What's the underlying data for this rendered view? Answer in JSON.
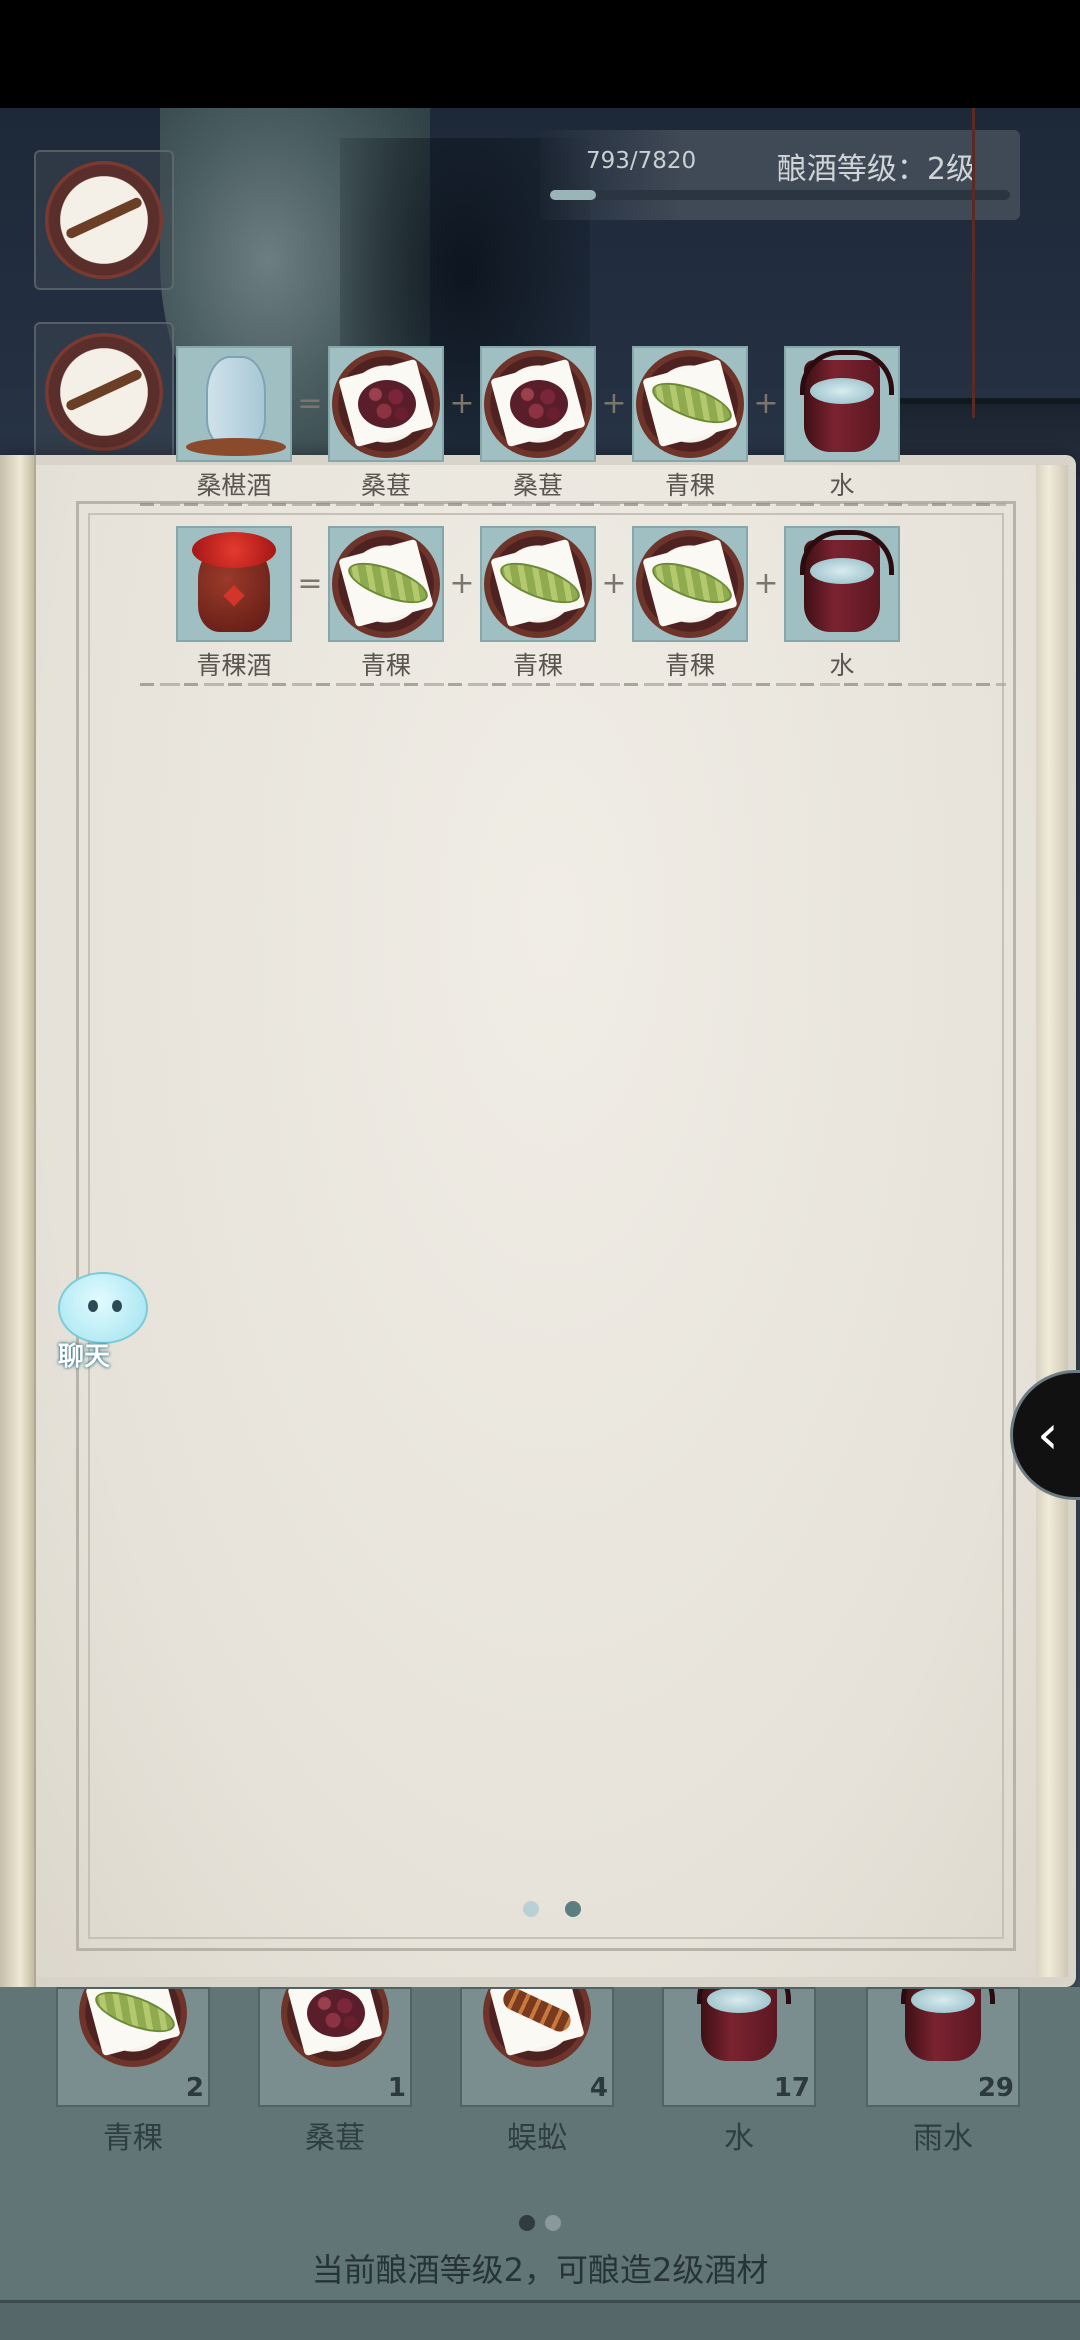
{
  "header": {
    "xp_text": "793/7820",
    "xp_progress": 0.101,
    "level_text": "酿酒等级：2级"
  },
  "recipes": [
    {
      "result": {
        "name": "桑椹酒",
        "icon": "teapot-icon"
      },
      "ingredients": [
        {
          "name": "桑葚",
          "icon": "mulberry-plate-icon"
        },
        {
          "name": "桑葚",
          "icon": "mulberry-plate-icon"
        },
        {
          "name": "青稞",
          "icon": "barley-plate-icon"
        },
        {
          "name": "水",
          "icon": "water-bucket-icon"
        }
      ]
    },
    {
      "result": {
        "name": "青稞酒",
        "icon": "wine-jar-icon"
      },
      "ingredients": [
        {
          "name": "青稞",
          "icon": "barley-plate-icon"
        },
        {
          "name": "青稞",
          "icon": "barley-plate-icon"
        },
        {
          "name": "青稞",
          "icon": "barley-plate-icon"
        },
        {
          "name": "水",
          "icon": "water-bucket-icon"
        }
      ]
    }
  ],
  "operators": {
    "equals": "=",
    "plus": "+"
  },
  "book": {
    "page_count": 2,
    "current_page": 2
  },
  "chat": {
    "label": "聊天"
  },
  "collapse_glyph": "‹",
  "inventory": {
    "items": [
      {
        "name": "青稞",
        "count": "2",
        "icon": "barley-plate-icon"
      },
      {
        "name": "桑葚",
        "count": "1",
        "icon": "mulberry-plate-icon"
      },
      {
        "name": "蜈蚣",
        "count": "4",
        "icon": "centipede-plate-icon"
      },
      {
        "name": "水",
        "count": "17",
        "icon": "water-bucket-icon"
      },
      {
        "name": "雨水",
        "count": "29",
        "icon": "rain-water-bucket-icon"
      }
    ],
    "page_count": 2,
    "current_page": 1,
    "status_text": "当前酿酒等级2，可酿造2级酒材"
  }
}
